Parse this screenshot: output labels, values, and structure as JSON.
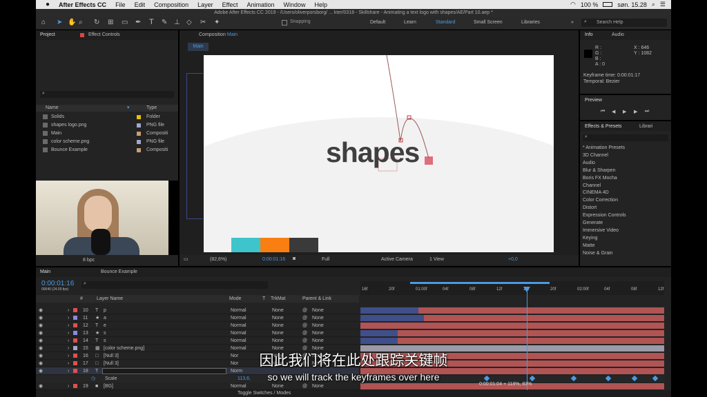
{
  "menubar": {
    "app": "After Effects CC",
    "items": [
      "File",
      "Edit",
      "Composition",
      "Layer",
      "Effect",
      "Animation",
      "Window",
      "Help"
    ],
    "battery": "100 %",
    "clock": "søn. 15.28"
  },
  "title": "Adobe After Effects CC 2019 - /Users/oliverporsborg/ ... kter/0318 - Skillshare - Animating a text logo with shapes/AE/Part 10.aep *",
  "toolbar": {
    "snapping": "Snapping",
    "workspaces": [
      "Default",
      "Learn",
      "Standard",
      "Small Screen",
      "Libraries"
    ],
    "active": "Standard",
    "search": "Search Help"
  },
  "project": {
    "tab": "Project",
    "effect_tab": "Effect Controls",
    "col_name": "Name",
    "col_type": "Type",
    "items": [
      {
        "name": "Solids",
        "type": "Folder",
        "color": "#e5c100"
      },
      {
        "name": "shapes logo.png",
        "type": "PNG file",
        "color": "#a1a9c9"
      },
      {
        "name": "Main",
        "type": "Compositi",
        "color": "#c89e72"
      },
      {
        "name": "color scheme.png",
        "type": "PNG file",
        "color": "#a1a9c9"
      },
      {
        "name": "Bounce Example",
        "type": "Compositi",
        "color": "#c89e72"
      }
    ],
    "bpc": "8 bpc"
  },
  "comp": {
    "tab": "Composition",
    "name": "Main",
    "crumb": "Main",
    "text": "shapes",
    "swatches": [
      "#3ec5cb",
      "#f97f12",
      "#3a3a3a"
    ],
    "bottom": {
      "zoom": "(82,6%)",
      "time": "0:00:01:16",
      "res": "Full",
      "camera": "Active Camera",
      "view": "1 View",
      "exposure": "+0,0"
    }
  },
  "info": {
    "tab": "Info",
    "tab2": "Audio",
    "r": "R :",
    "g": "G :",
    "b": "B :",
    "a": "A : 0",
    "x": "X : 646",
    "y": "Y : 1082",
    "kt": "Keyframe time: 0:00:01:17",
    "temporal": "Temporal: Bezier"
  },
  "preview": {
    "tab": "Preview"
  },
  "effects": {
    "tab": "Effects & Presets",
    "tab2": "Librari",
    "items": [
      "* Animation Presets",
      "3D Channel",
      "Audio",
      "Blur & Sharpen",
      "Boris FX Mocha",
      "Channel",
      "CINEMA 4D",
      "Color Correction",
      "Distort",
      "Expression Controls",
      "Generate",
      "Immersive Video",
      "Keying",
      "Matte",
      "Noise & Grain"
    ]
  },
  "timeline": {
    "tabs": [
      "Main",
      "Bounce Example"
    ],
    "time": "0:00:01:16",
    "frames": "00040 (24.00 fps)",
    "cols": {
      "num": "#",
      "layer": "Layer Name",
      "mode": "Mode",
      "t": "T",
      "trkmat": "TrkMat",
      "parent": "Parent & Link"
    },
    "ticks": [
      "16f",
      "20f",
      "01:00f",
      "04f",
      "08f",
      "12f",
      "16f",
      "20f",
      "02:00f",
      "04f",
      "08f",
      "12f"
    ],
    "layers": [
      {
        "num": "10",
        "type": "T",
        "name": "p",
        "color": "#e05050",
        "mode": "Normal",
        "trk": "None",
        "parent": "None"
      },
      {
        "num": "11",
        "type": "★",
        "name": "a",
        "color": "#8a8ae0",
        "mode": "Normal",
        "trk": "None",
        "parent": "None"
      },
      {
        "num": "12",
        "type": "T",
        "name": "e",
        "color": "#e05050",
        "mode": "Normal",
        "trk": "None",
        "parent": "None"
      },
      {
        "num": "13",
        "type": "★",
        "name": "s",
        "color": "#8a8ae0",
        "mode": "Normal",
        "trk": "None",
        "parent": "None"
      },
      {
        "num": "14",
        "type": "T",
        "name": "s",
        "color": "#e05050",
        "mode": "Normal",
        "trk": "None",
        "parent": "None"
      },
      {
        "num": "15",
        "type": "▦",
        "name": "[color scheme.png]",
        "color": "#a1a9c9",
        "mode": "Normal",
        "trk": "None",
        "parent": "None"
      },
      {
        "num": "16",
        "type": "□",
        "name": "[Null 3]",
        "color": "#e05050",
        "mode": "Nor",
        "trk": "None",
        "parent": "None"
      },
      {
        "num": "17",
        "type": "□",
        "name": "[Null 3]",
        "color": "#e05050",
        "mode": "Nor",
        "trk": "None",
        "parent": "None"
      },
      {
        "num": "18",
        "type": "T",
        "name": "",
        "color": "#e05050",
        "mode": "Norm",
        "trk": "",
        "parent": ""
      },
      {
        "num": "19",
        "type": "■",
        "name": "[BG]",
        "color": "#e05050",
        "mode": "Normal",
        "trk": "None",
        "parent": "None"
      }
    ],
    "scale": {
      "label": "Scale",
      "value": "113,6,"
    },
    "toggle": "Toggle Switches / Modes",
    "tooltip": "0:00:01:04 + 118%, 83%"
  },
  "subtitle": {
    "zh": "因此我们将在此处跟踪关键帧",
    "en": "so we will track the keyframes over here"
  }
}
